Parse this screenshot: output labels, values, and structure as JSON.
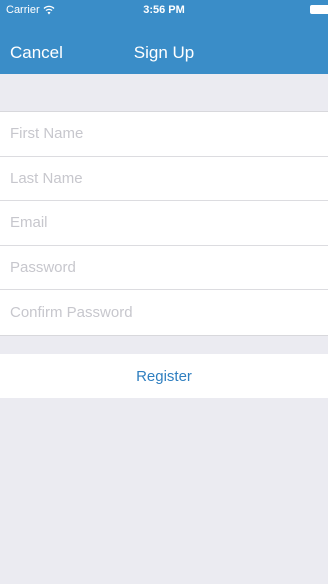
{
  "status_bar": {
    "carrier": "Carrier",
    "time": "3:56 PM",
    "wifi_icon": "wifi-icon",
    "battery_icon": "battery-icon"
  },
  "nav_bar": {
    "cancel_label": "Cancel",
    "title": "Sign Up"
  },
  "form": {
    "fields": [
      {
        "name": "first-name",
        "placeholder": "First Name",
        "value": ""
      },
      {
        "name": "last-name",
        "placeholder": "Last Name",
        "value": ""
      },
      {
        "name": "email",
        "placeholder": "Email",
        "value": ""
      },
      {
        "name": "password",
        "placeholder": "Password",
        "value": ""
      },
      {
        "name": "confirm-password",
        "placeholder": "Confirm Password",
        "value": ""
      }
    ]
  },
  "register_label": "Register",
  "colors": {
    "header_background": "#3a8dc8",
    "page_background": "#ebebf1",
    "accent": "#2f7fc0",
    "placeholder": "#c7c7cd"
  }
}
